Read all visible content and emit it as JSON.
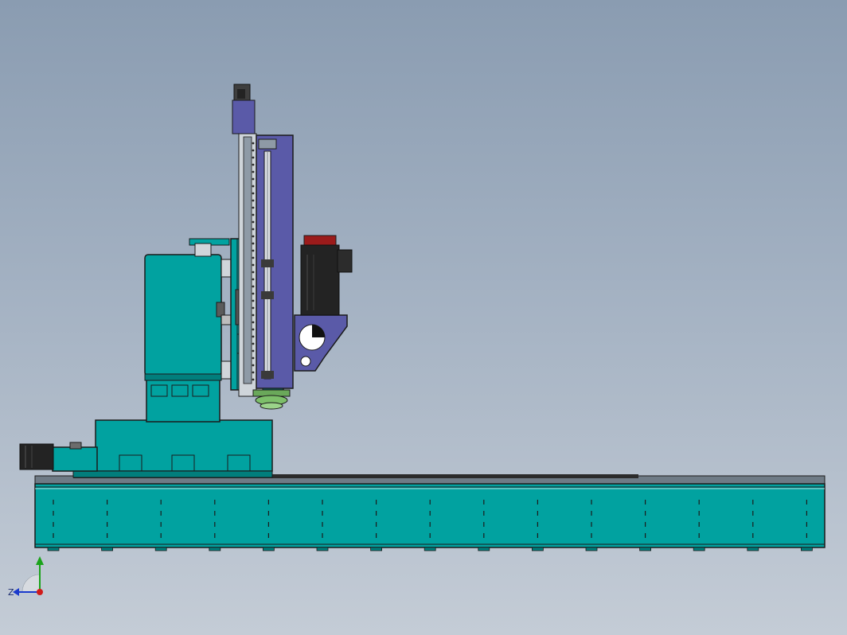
{
  "viewport": {
    "background_top": "#8a9cb1",
    "background_bottom": "#c4ccd6"
  },
  "model": {
    "colors": {
      "body_teal": "#01a2a0",
      "body_teal_dark": "#017e7c",
      "slide_purple": "#5a5aa8",
      "motor_black": "#232323",
      "motor_cap_red": "#9b1b1b",
      "edge_dark": "#1b1b1b",
      "rail_gray": "#8e9aa6",
      "tool_green": "#7dbf6a"
    }
  },
  "triad": {
    "z_label": "Z",
    "y_color": "#1aa31a",
    "x_color": "#d01a1a",
    "z_color": "#1a3acc"
  }
}
